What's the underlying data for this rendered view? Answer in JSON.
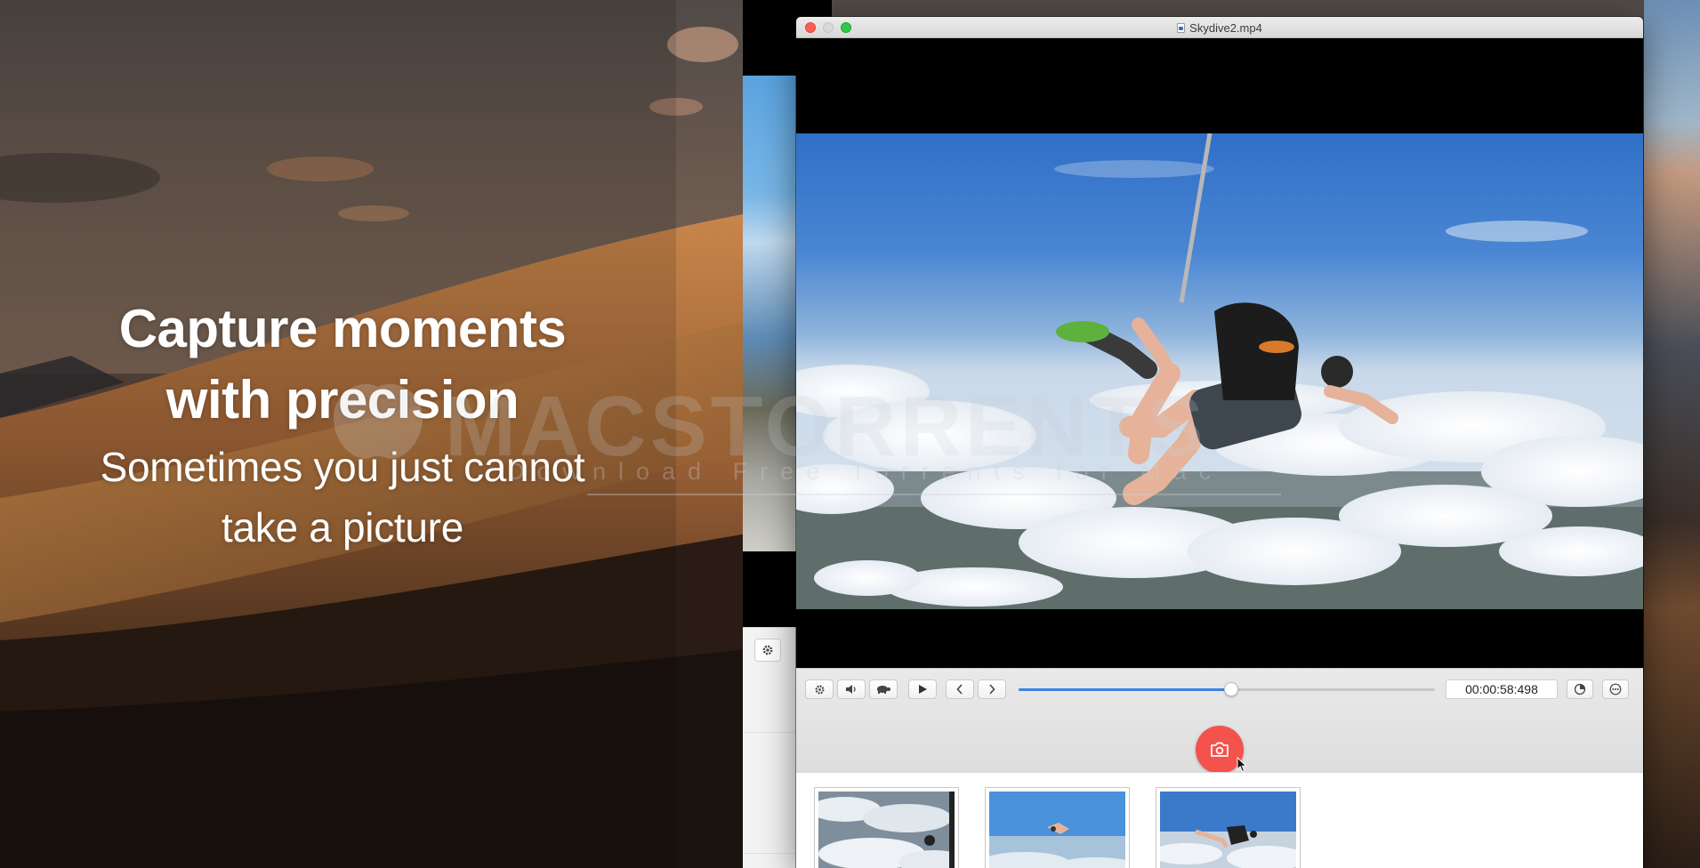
{
  "headline": {
    "title_line1": "Capture moments",
    "title_line2": "with precision",
    "subtitle_line1": "Sometimes you just cannot",
    "subtitle_line2": "take a picture"
  },
  "window": {
    "title": "Skydive2.mp4"
  },
  "player": {
    "timecode": "00:00:58:498",
    "progress_fraction": 0.51,
    "buttons": {
      "settings": "gear-icon",
      "volume": "speaker-icon",
      "speed": "turtle-icon",
      "play": "play-icon",
      "prev_frame": "chevron-left-icon",
      "next_frame": "chevron-right-icon",
      "timer": "pie-timer-icon",
      "more": "ellipsis-icon",
      "capture": "camera-icon"
    }
  },
  "watermark": {
    "brand": "MACSTORRENTS",
    "tagline": "Download Free Torrents for Mac",
    "domain": ".com"
  },
  "colors": {
    "accent_blue": "#3b82e6",
    "capture_red": "#f4524c",
    "close_red": "#fc5f57",
    "zoom_green": "#34c84a"
  }
}
